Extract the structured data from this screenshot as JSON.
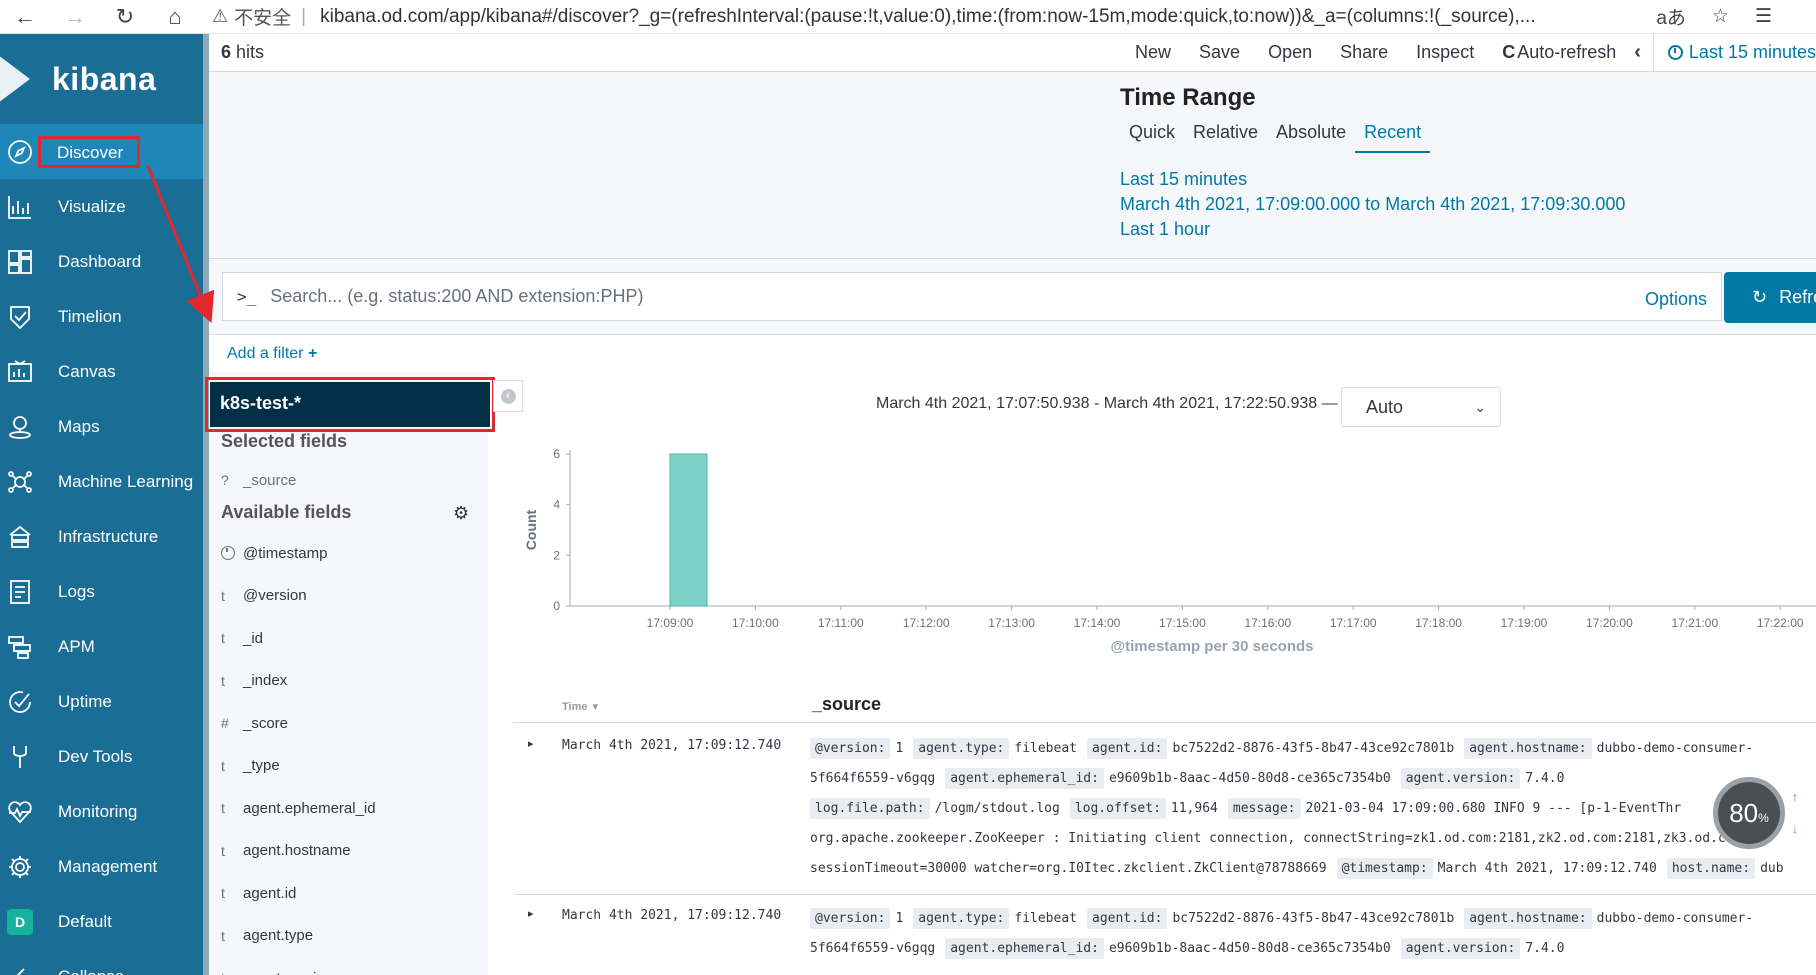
{
  "browser": {
    "security_label": "不安全",
    "separator": "|",
    "url": "kibana.od.com/app/kibana#/discover?_g=(refreshInterval:(pause:!t,value:0),time:(from:now-15m,mode:quick,to:now))&_a=(columns:!(_source),...",
    "translate_label": "aあ"
  },
  "app": {
    "logo_text": "kibana"
  },
  "sidebar": {
    "items": [
      {
        "label": "Discover",
        "icon": "compass-icon"
      },
      {
        "label": "Visualize",
        "icon": "visualize-icon"
      },
      {
        "label": "Dashboard",
        "icon": "dashboard-icon"
      },
      {
        "label": "Timelion",
        "icon": "timelion-icon"
      },
      {
        "label": "Canvas",
        "icon": "canvas-icon"
      },
      {
        "label": "Maps",
        "icon": "maps-icon"
      },
      {
        "label": "Machine Learning",
        "icon": "machine-learning-icon"
      },
      {
        "label": "Infrastructure",
        "icon": "infrastructure-icon"
      },
      {
        "label": "Logs",
        "icon": "logs-icon"
      },
      {
        "label": "APM",
        "icon": "apm-icon"
      },
      {
        "label": "Uptime",
        "icon": "uptime-icon"
      },
      {
        "label": "Dev Tools",
        "icon": "dev-tools-icon"
      },
      {
        "label": "Monitoring",
        "icon": "monitoring-icon"
      },
      {
        "label": "Management",
        "icon": "gear-icon"
      },
      {
        "label": "Default",
        "icon": "space-badge-icon",
        "badge": "D"
      },
      {
        "label": "Collapse",
        "icon": "collapse-icon"
      }
    ]
  },
  "topnav": {
    "hits_count": "6",
    "hits_suffix": "hits",
    "links": [
      "New",
      "Save",
      "Open",
      "Share",
      "Inspect"
    ],
    "auto_refresh": "Auto-refresh",
    "time_label": "Last 15 minutes"
  },
  "time_range": {
    "title": "Time Range",
    "tabs": [
      "Quick",
      "Relative",
      "Absolute",
      "Recent"
    ],
    "active_tab": "Recent",
    "recent": [
      "Last 15 minutes",
      "March 4th 2021, 17:09:00.000 to March 4th 2021, 17:09:30.000",
      "Last 1 hour"
    ]
  },
  "search": {
    "prompt": ">_",
    "placeholder": "Search... (e.g. status:200 AND extension:PHP)",
    "options_label": "Options",
    "refresh_label": "Refresh"
  },
  "filter": {
    "add_filter_label": "Add a filter",
    "plus": "+"
  },
  "fields": {
    "index_pattern": "k8s-test-*",
    "selected_title": "Selected fields",
    "selected": [
      {
        "type": "?",
        "name": "_source"
      }
    ],
    "available_title": "Available fields",
    "available": [
      {
        "type": "clock",
        "name": "@timestamp"
      },
      {
        "type": "t",
        "name": "@version"
      },
      {
        "type": "t",
        "name": "_id"
      },
      {
        "type": "t",
        "name": "_index"
      },
      {
        "type": "#",
        "name": "_score"
      },
      {
        "type": "t",
        "name": "_type"
      },
      {
        "type": "t",
        "name": "agent.ephemeral_id"
      },
      {
        "type": "t",
        "name": "agent.hostname"
      },
      {
        "type": "t",
        "name": "agent.id"
      },
      {
        "type": "t",
        "name": "agent.type"
      },
      {
        "type": "t",
        "name": "agent.version"
      }
    ]
  },
  "histogram": {
    "range_label": "March 4th 2021, 17:07:50.938 - March 4th 2021, 17:22:50.938 —",
    "interval": "Auto"
  },
  "chart_data": {
    "type": "bar",
    "categories": [
      "17:09:00"
    ],
    "values": [
      6
    ],
    "x_ticks": [
      "17:09:00",
      "17:10:00",
      "17:11:00",
      "17:12:00",
      "17:13:00",
      "17:14:00",
      "17:15:00",
      "17:16:00",
      "17:17:00",
      "17:18:00",
      "17:19:00",
      "17:20:00",
      "17:21:00",
      "17:22:00"
    ],
    "y_ticks": [
      0,
      2,
      4,
      6
    ],
    "ylim": [
      0,
      6
    ],
    "xlabel": "@timestamp per 30 seconds",
    "ylabel": "Count",
    "bar_color": "#79d1c8",
    "grid": false
  },
  "table": {
    "col_time": "Time",
    "col_source": "_source",
    "rows": [
      {
        "time": "March 4th 2021, 17:09:12.740",
        "lines": [
          [
            [
              "@version:",
              "1"
            ],
            [
              "agent.type:",
              "filebeat"
            ],
            [
              "agent.id:",
              "bc7522d2-8876-43f5-8b47-43ce92c7801b"
            ],
            [
              "agent.hostname:",
              "dubbo-demo-consumer-"
            ]
          ],
          [
            [
              "",
              "5f664f6559-v6gqg"
            ],
            [
              "agent.ephemeral_id:",
              "e9609b1b-8aac-4d50-80d8-ce365c7354b0"
            ],
            [
              "agent.version:",
              "7.4.0"
            ]
          ],
          [
            [
              "log.file.path:",
              "/logm/stdout.log"
            ],
            [
              "log.offset:",
              "11,964"
            ],
            [
              "message:",
              "2021-03-04 17:09:00.680 INFO 9 --- [p-1-EventThr"
            ]
          ],
          [
            [
              "",
              "org.apache.zookeeper.ZooKeeper : Initiating client connection, connectString=zk1.od.com:2181,zk2.od.com:2181,zk3.od.com:218"
            ]
          ],
          [
            [
              "",
              "sessionTimeout=30000 watcher=org.I0Itec.zkclient.ZkClient@78788669"
            ],
            [
              "@timestamp:",
              "March 4th 2021, 17:09:12.740"
            ],
            [
              "host.name:",
              "dub"
            ]
          ]
        ]
      },
      {
        "time": "March 4th 2021, 17:09:12.740",
        "lines": [
          [
            [
              "@version:",
              "1"
            ],
            [
              "agent.type:",
              "filebeat"
            ],
            [
              "agent.id:",
              "bc7522d2-8876-43f5-8b47-43ce92c7801b"
            ],
            [
              "agent.hostname:",
              "dubbo-demo-consumer-"
            ]
          ],
          [
            [
              "",
              "5f664f6559-v6gqg"
            ],
            [
              "agent.ephemeral_id:",
              "e9609b1b-8aac-4d50-80d8-ce365c7354b0"
            ],
            [
              "agent.version:",
              "7.4.0"
            ]
          ]
        ]
      }
    ]
  },
  "overlay": {
    "speed_value": "80",
    "speed_unit": "%",
    "up_arrow": "↑",
    "down_arrow": "↓"
  },
  "colors": {
    "sidebar": "#1a6d94",
    "sidebar_active": "#1f86b8",
    "link": "#0079a5",
    "index_pattern_bg": "#002f46",
    "annotation_red": "#e0282e"
  }
}
